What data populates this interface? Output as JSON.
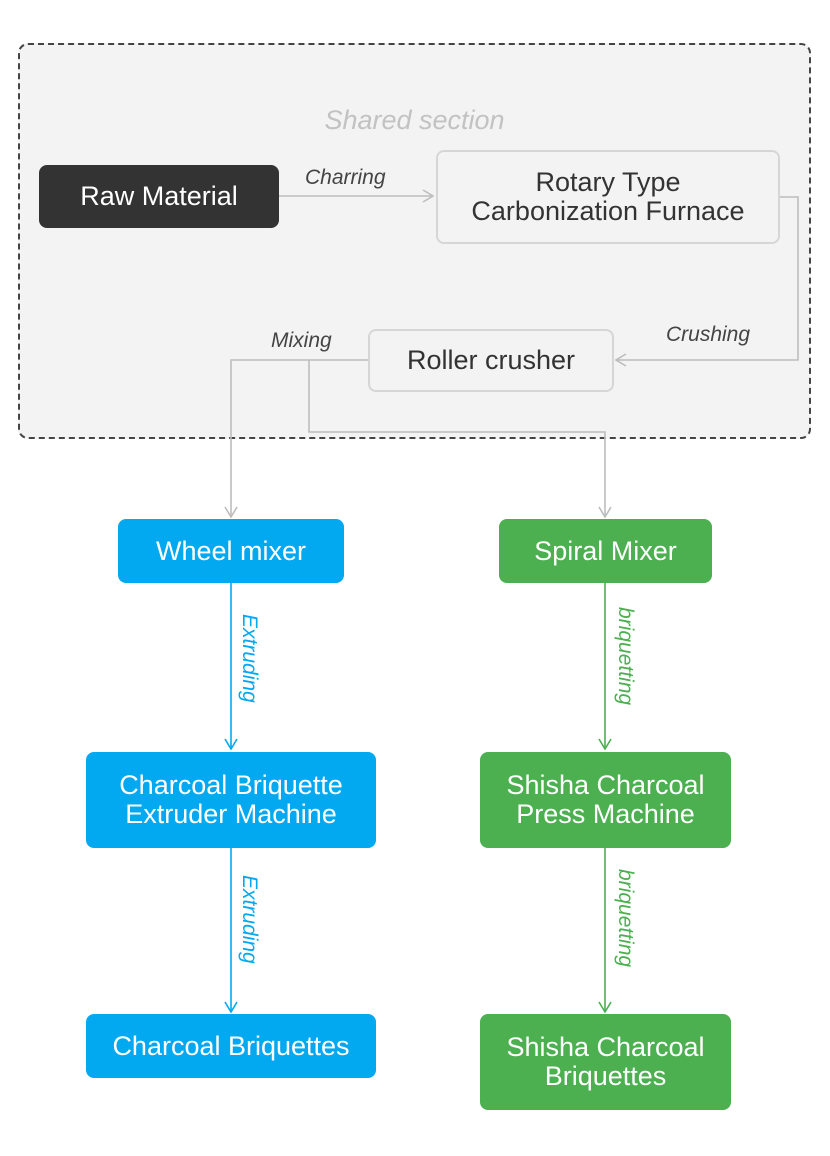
{
  "group": {
    "title": "Shared section"
  },
  "nodes": {
    "raw_material": "Raw Material",
    "furnace": "Rotary Type\nCarbonization Furnace",
    "roller_crusher": "Roller crusher",
    "wheel_mixer": "Wheel mixer",
    "spiral_mixer": "Spiral Mixer",
    "extruder_machine": "Charcoal Briquette\nExtruder Machine",
    "shisha_press": "Shisha Charcoal\nPress Machine",
    "charcoal_briquettes": "Charcoal Briquettes",
    "shisha_briquettes": "Shisha Charcoal\nBriquettes"
  },
  "edges": {
    "charring": "Charring",
    "crushing": "Crushing",
    "mixing": "Mixing",
    "extruding_1": "Extruding",
    "extruding_2": "Extruding",
    "briquetting_1": "briquetting",
    "briquetting_2": "briquetting"
  },
  "colors": {
    "blue": "#03a9f0",
    "green": "#4caf50",
    "dark": "#333333",
    "gray_edge": "#bdbdbd"
  }
}
